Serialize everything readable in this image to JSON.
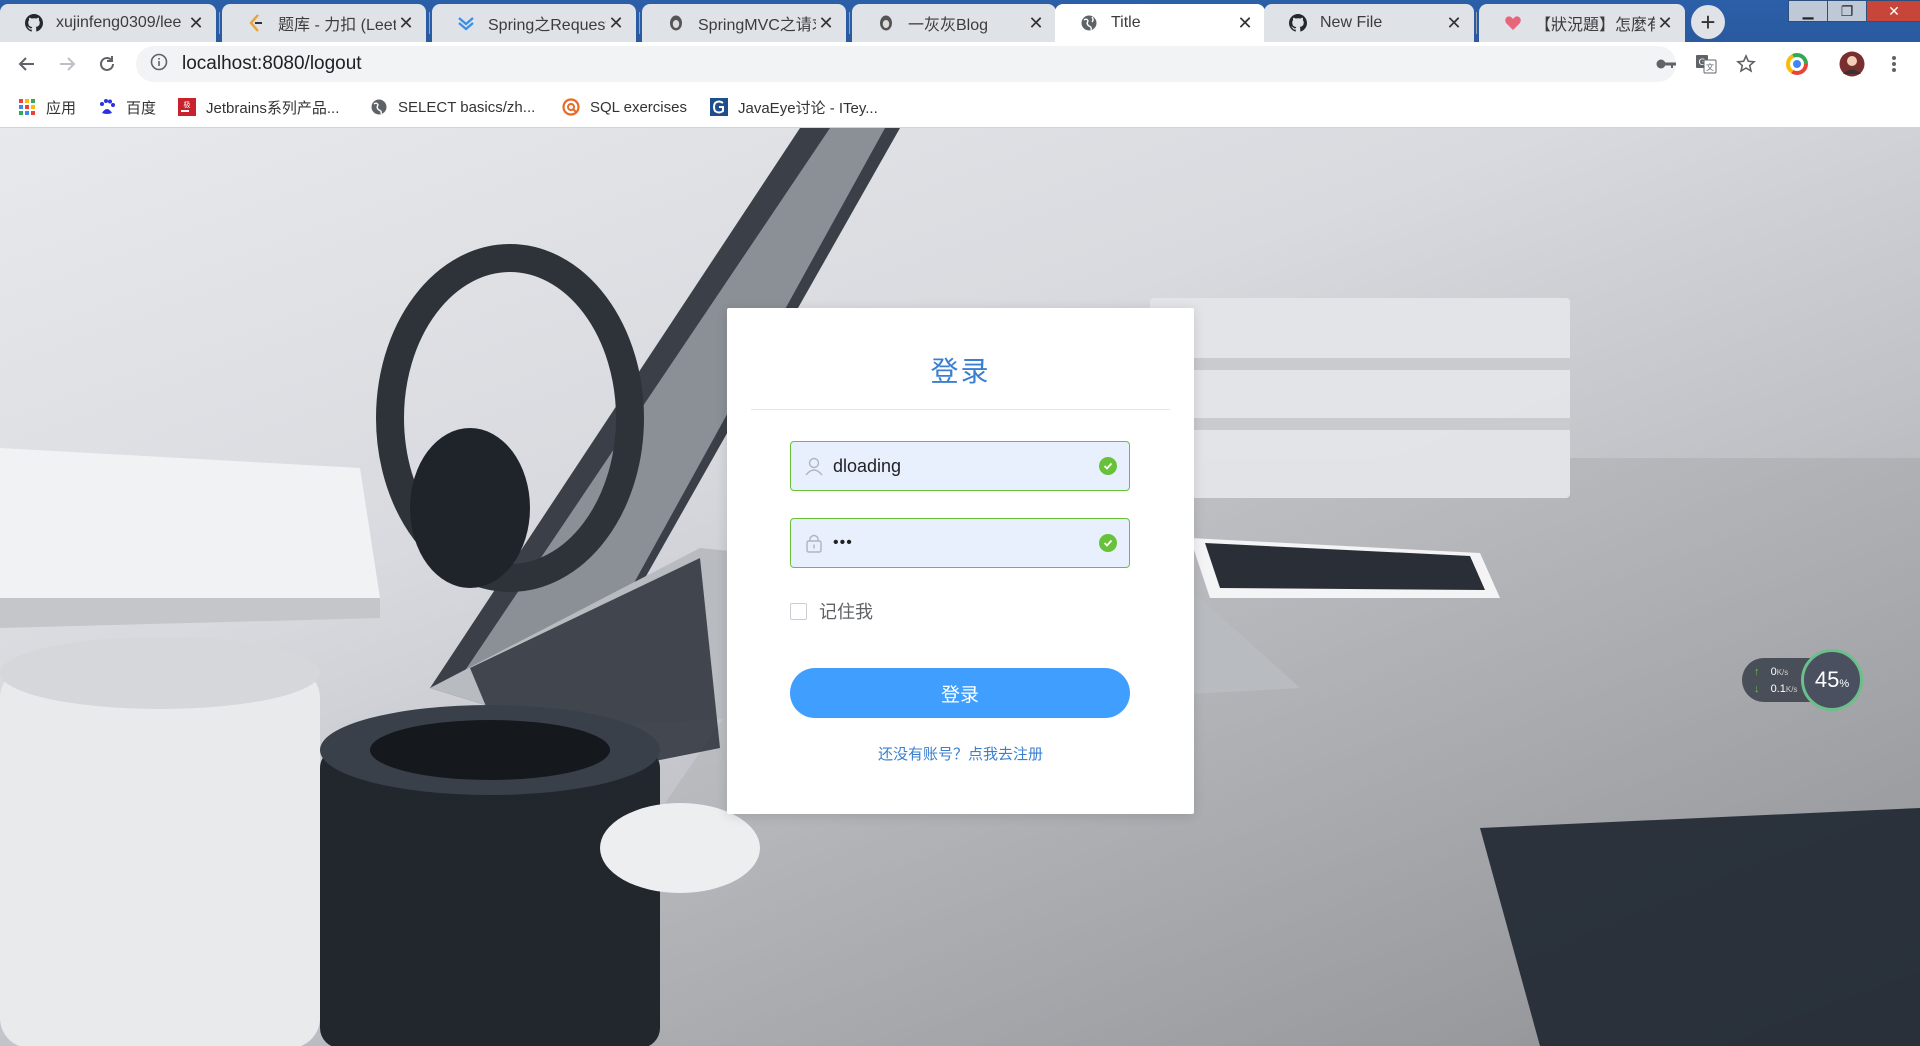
{
  "tabs": [
    {
      "title": "xujinfeng0309/lee",
      "icon": "github-icon"
    },
    {
      "title": "题库 - 力扣 (LeetC",
      "icon": "leetcode-icon"
    },
    {
      "title": "Spring之RequestB",
      "icon": "spring-doc-icon"
    },
    {
      "title": "SpringMVC之请求",
      "icon": "blog-logo-icon"
    },
    {
      "title": "一灰灰Blog",
      "icon": "blog-logo-icon"
    },
    {
      "title": "Title",
      "icon": "globe-icon"
    },
    {
      "title": "New File",
      "icon": "github-icon"
    },
    {
      "title": "【狀況題】怎麼有",
      "icon": "heart-icon"
    }
  ],
  "address": {
    "url": "localhost:8080/logout"
  },
  "bookmarks": [
    {
      "label": "应用",
      "icon": "apps-grid-icon"
    },
    {
      "label": "百度",
      "icon": "baidu-paw-icon"
    },
    {
      "label": "Jetbrains系列产品...",
      "icon": "jetbrains-icon"
    },
    {
      "label": "SELECT basics/zh...",
      "icon": "globe-icon"
    },
    {
      "label": "SQL exercises",
      "icon": "sql-exercises-icon"
    },
    {
      "label": "JavaEye讨论 - ITey...",
      "icon": "javaeye-icon"
    }
  ],
  "login": {
    "title": "登录",
    "username_value": "dloading",
    "password_value": "•••",
    "remember_label": "记住我",
    "remember_checked": false,
    "submit_label": "登录",
    "register_link": "还没有账号？点我去注册"
  },
  "netspeed": {
    "upload": "0",
    "upload_unit": "K/s",
    "download": "0.1",
    "download_unit": "K/s",
    "cpu_percent": "45",
    "cpu_unit": "%"
  },
  "colors": {
    "accent": "#409eff",
    "title_blue": "#3b7fd0",
    "valid_green": "#67c23a",
    "tabstrip": "#2b5fa8"
  }
}
